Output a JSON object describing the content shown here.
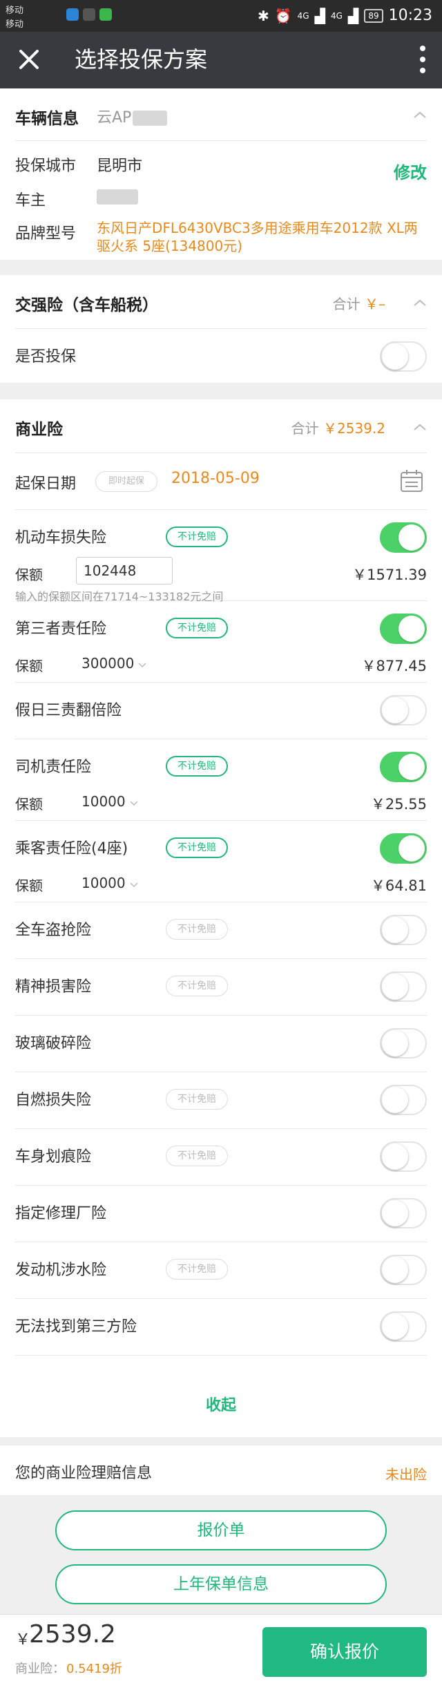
{
  "statusbar": {
    "carrier1": "移动",
    "carrier2": "移动",
    "signal1": "4G",
    "signal2": "4G",
    "battery": "89",
    "time": "10:23"
  },
  "toolbar": {
    "title": "选择投保方案"
  },
  "vehicle": {
    "heading": "车辆信息",
    "plate": "云AP",
    "city_label": "投保城市",
    "city_value": "昆明市",
    "modify": "修改",
    "owner_label": "车主",
    "model_label": "品牌型号",
    "model_value_line1": "东风日产DFL6430VBC3多用途乘用车2012款 XL两",
    "model_value_line2": "驱火系 5座(134800元)"
  },
  "compulsory": {
    "heading": "交强险（含车船税）",
    "total_label": "合计",
    "total_value": "￥–",
    "insure_label": "是否投保",
    "insure_on": false
  },
  "commercial": {
    "heading": "商业险",
    "total_label": "合计",
    "total_value": "￥2539.2",
    "start_label": "起保日期",
    "start_chip": "即时起保",
    "start_date": "2018-05-09",
    "badge_label": "不计免赔",
    "amount_label": "保额",
    "items": [
      {
        "name": "机动车损失险",
        "on": true,
        "badge": true,
        "amount_input": "102448",
        "price": "￥1571.39",
        "hint": "输入的保额区间在71714~133182元之间"
      },
      {
        "name": "第三者责任险",
        "on": true,
        "badge": true,
        "amount_select": "300000",
        "price": "￥877.45"
      },
      {
        "name": "假日三责翻倍险",
        "on": false,
        "badge": null
      },
      {
        "name": "司机责任险",
        "on": true,
        "badge": true,
        "amount_select": "10000",
        "price": "￥25.55"
      },
      {
        "name": "乘客责任险(4座)",
        "on": true,
        "badge": true,
        "amount_select": "10000",
        "price": "￥64.81"
      },
      {
        "name": "全车盗抢险",
        "on": false,
        "badge": false
      },
      {
        "name": "精神损害险",
        "on": false,
        "badge": false
      },
      {
        "name": "玻璃破碎险",
        "on": false,
        "badge": null
      },
      {
        "name": "自燃损失险",
        "on": false,
        "badge": false
      },
      {
        "name": "车身划痕险",
        "on": false,
        "badge": false
      },
      {
        "name": "指定修理厂险",
        "on": false,
        "badge": null
      },
      {
        "name": "发动机涉水险",
        "on": false,
        "badge": false
      },
      {
        "name": "无法找到第三方险",
        "on": false,
        "badge": null
      }
    ],
    "collapse": "收起"
  },
  "claims": {
    "label": "您的商业险理赔信息",
    "value": "未出险"
  },
  "buttons": {
    "quote": "报价单",
    "last_year": "上年保单信息"
  },
  "bottom": {
    "currency": "￥",
    "total": "2539.2",
    "discount_label": "商业险：",
    "discount_value": "0.5419折",
    "confirm": "确认报价"
  },
  "colors": {
    "accent_green": "#20b87a",
    "toggle_green": "#4cd068",
    "orange": "#e8891c",
    "toolbar": "#393a3f"
  }
}
